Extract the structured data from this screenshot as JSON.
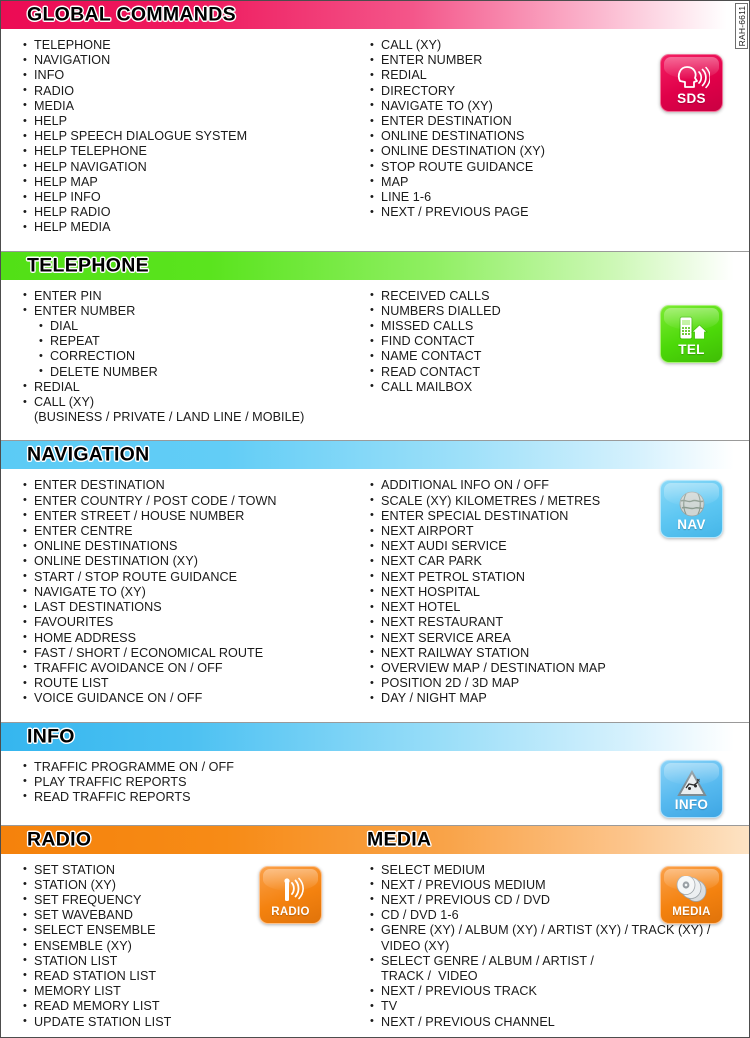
{
  "side_code": "RAH-6611",
  "sections": [
    {
      "id": "global-commands",
      "title": "GLOBAL COMMANDS",
      "badge": {
        "label": "SDS",
        "icon": "head-speaking-icon"
      },
      "left_items": [
        {
          "text": "TELEPHONE",
          "level": 1
        },
        {
          "text": "NAVIGATION",
          "level": 1
        },
        {
          "text": "INFO",
          "level": 1
        },
        {
          "text": "RADIO",
          "level": 1
        },
        {
          "text": "MEDIA",
          "level": 1
        },
        {
          "text": "HELP",
          "level": 1
        },
        {
          "text": "HELP SPEECH DIALOGUE SYSTEM",
          "level": 1
        },
        {
          "text": "HELP TELEPHONE",
          "level": 1
        },
        {
          "text": "HELP NAVIGATION",
          "level": 1
        },
        {
          "text": "HELP MAP",
          "level": 1
        },
        {
          "text": "HELP INFO",
          "level": 1
        },
        {
          "text": "HELP RADIO",
          "level": 1
        },
        {
          "text": "HELP MEDIA",
          "level": 1
        }
      ],
      "right_items": [
        {
          "text": "CALL (XY)",
          "level": 1
        },
        {
          "text": "ENTER NUMBER",
          "level": 1
        },
        {
          "text": "REDIAL",
          "level": 1
        },
        {
          "text": "DIRECTORY",
          "level": 1
        },
        {
          "text": "NAVIGATE TO (XY)",
          "level": 1
        },
        {
          "text": "ENTER DESTINATION",
          "level": 1
        },
        {
          "text": "ONLINE DESTINATIONS",
          "level": 1
        },
        {
          "text": "ONLINE DESTINATION (XY)",
          "level": 1
        },
        {
          "text": "STOP ROUTE GUIDANCE",
          "level": 1
        },
        {
          "text": "MAP",
          "level": 1
        },
        {
          "text": "LINE 1-6",
          "level": 1
        },
        {
          "text": "NEXT / PREVIOUS PAGE",
          "level": 1
        }
      ]
    },
    {
      "id": "telephone",
      "title": "TELEPHONE",
      "badge": {
        "label": "TEL",
        "icon": "mobile-phone-house-icon"
      },
      "left_items": [
        {
          "text": "ENTER PIN",
          "level": 1
        },
        {
          "text": "ENTER NUMBER",
          "level": 1
        },
        {
          "text": "DIAL",
          "level": 2
        },
        {
          "text": "REPEAT",
          "level": 2
        },
        {
          "text": "CORRECTION",
          "level": 2
        },
        {
          "text": "DELETE NUMBER",
          "level": 2
        },
        {
          "text": "REDIAL",
          "level": 1
        },
        {
          "text": "CALL (XY)",
          "level": 1
        },
        {
          "text": "(BUSINESS / PRIVATE / LAND LINE / MOBILE)",
          "level": 0
        }
      ],
      "right_items": [
        {
          "text": "RECEIVED CALLS",
          "level": 1
        },
        {
          "text": "NUMBERS DIALLED",
          "level": 1
        },
        {
          "text": "MISSED CALLS",
          "level": 1
        },
        {
          "text": "FIND CONTACT",
          "level": 1
        },
        {
          "text": "NAME CONTACT",
          "level": 1
        },
        {
          "text": "READ CONTACT",
          "level": 1
        },
        {
          "text": "CALL MAILBOX",
          "level": 1
        }
      ]
    },
    {
      "id": "navigation",
      "title": "NAVIGATION",
      "badge": {
        "label": "NAV",
        "icon": "globe-icon"
      },
      "left_items": [
        {
          "text": "ENTER DESTINATION",
          "level": 1
        },
        {
          "text": "ENTER COUNTRY / POST CODE / TOWN",
          "level": 1
        },
        {
          "text": "ENTER STREET / HOUSE NUMBER",
          "level": 1
        },
        {
          "text": "ENTER CENTRE",
          "level": 1
        },
        {
          "text": "ONLINE DESTINATIONS",
          "level": 1
        },
        {
          "text": "ONLINE DESTINATION (XY)",
          "level": 1
        },
        {
          "text": "START / STOP ROUTE GUIDANCE",
          "level": 1
        },
        {
          "text": "NAVIGATE TO (XY)",
          "level": 1
        },
        {
          "text": "LAST DESTINATIONS",
          "level": 1
        },
        {
          "text": "FAVOURITES",
          "level": 1
        },
        {
          "text": "HOME ADDRESS",
          "level": 1
        },
        {
          "text": "FAST / SHORT / ECONOMICAL ROUTE",
          "level": 1
        },
        {
          "text": "TRAFFIC AVOIDANCE ON / OFF",
          "level": 1
        },
        {
          "text": "ROUTE LIST",
          "level": 1
        },
        {
          "text": "VOICE GUIDANCE ON / OFF",
          "level": 1
        }
      ],
      "right_items": [
        {
          "text": "ADDITIONAL INFO ON / OFF",
          "level": 1
        },
        {
          "text": "SCALE (XY) KILOMETRES / METRES",
          "level": 1
        },
        {
          "text": "ENTER SPECIAL DESTINATION",
          "level": 1
        },
        {
          "text": "NEXT AIRPORT",
          "level": 1
        },
        {
          "text": "NEXT AUDI SERVICE",
          "level": 1
        },
        {
          "text": "NEXT CAR PARK",
          "level": 1
        },
        {
          "text": "NEXT PETROL STATION",
          "level": 1
        },
        {
          "text": "NEXT HOSPITAL",
          "level": 1
        },
        {
          "text": "NEXT HOTEL",
          "level": 1
        },
        {
          "text": "NEXT RESTAURANT",
          "level": 1
        },
        {
          "text": "NEXT SERVICE AREA",
          "level": 1
        },
        {
          "text": "NEXT RAILWAY STATION",
          "level": 1
        },
        {
          "text": "OVERVIEW MAP / DESTINATION MAP",
          "level": 1
        },
        {
          "text": "POSITION 2D / 3D MAP",
          "level": 1
        },
        {
          "text": "DAY / NIGHT MAP",
          "level": 1
        }
      ]
    },
    {
      "id": "info",
      "title": "INFO",
      "badge": {
        "label": "INFO",
        "icon": "warning-triangle-icon"
      },
      "left_items": [
        {
          "text": "TRAFFIC PROGRAMME ON / OFF",
          "level": 1
        },
        {
          "text": "PLAY TRAFFIC REPORTS",
          "level": 1
        },
        {
          "text": "READ TRAFFIC REPORTS",
          "level": 1
        }
      ],
      "right_items": []
    },
    {
      "id": "radio-media",
      "title": "RADIO",
      "title2": "MEDIA",
      "badge": {
        "label": "RADIO",
        "icon": "antenna-waves-icon"
      },
      "badge2": {
        "label": "MEDIA",
        "icon": "compact-discs-icon"
      },
      "left_items": [
        {
          "text": "SET STATION",
          "level": 1
        },
        {
          "text": "STATION (XY)",
          "level": 1
        },
        {
          "text": "SET FREQUENCY",
          "level": 1
        },
        {
          "text": "SET WAVEBAND",
          "level": 1
        },
        {
          "text": "SELECT ENSEMBLE",
          "level": 1
        },
        {
          "text": "ENSEMBLE (XY)",
          "level": 1
        },
        {
          "text": "STATION LIST",
          "level": 1
        },
        {
          "text": "READ STATION LIST",
          "level": 1
        },
        {
          "text": "MEMORY LIST",
          "level": 1
        },
        {
          "text": "READ MEMORY LIST",
          "level": 1
        },
        {
          "text": "UPDATE STATION LIST",
          "level": 1
        }
      ],
      "right_items": [
        {
          "text": "SELECT MEDIUM",
          "level": 1
        },
        {
          "text": "NEXT / PREVIOUS MEDIUM",
          "level": 1
        },
        {
          "text": "NEXT / PREVIOUS CD / DVD",
          "level": 1
        },
        {
          "text": "CD / DVD 1-6",
          "level": 1
        },
        {
          "text": "GENRE (XY) / ALBUM (XY) / ARTIST (XY) / TRACK (XY) /",
          "level": 1
        },
        {
          "text": "VIDEO (XY)",
          "level": 0
        },
        {
          "text": "SELECT GENRE / ALBUM / ARTIST /",
          "level": 1
        },
        {
          "text": "TRACK /  VIDEO",
          "level": 0
        },
        {
          "text": "NEXT / PREVIOUS TRACK",
          "level": 1
        },
        {
          "text": "TV",
          "level": 1
        },
        {
          "text": "NEXT / PREVIOUS CHANNEL",
          "level": 1
        }
      ]
    }
  ],
  "colors": {
    "global": "#ec0b54",
    "telephone": "#52e016",
    "navigation": "#5bcbf5",
    "info": "#35b6ef",
    "radio": "#f5820b",
    "media": "#f5820b"
  }
}
